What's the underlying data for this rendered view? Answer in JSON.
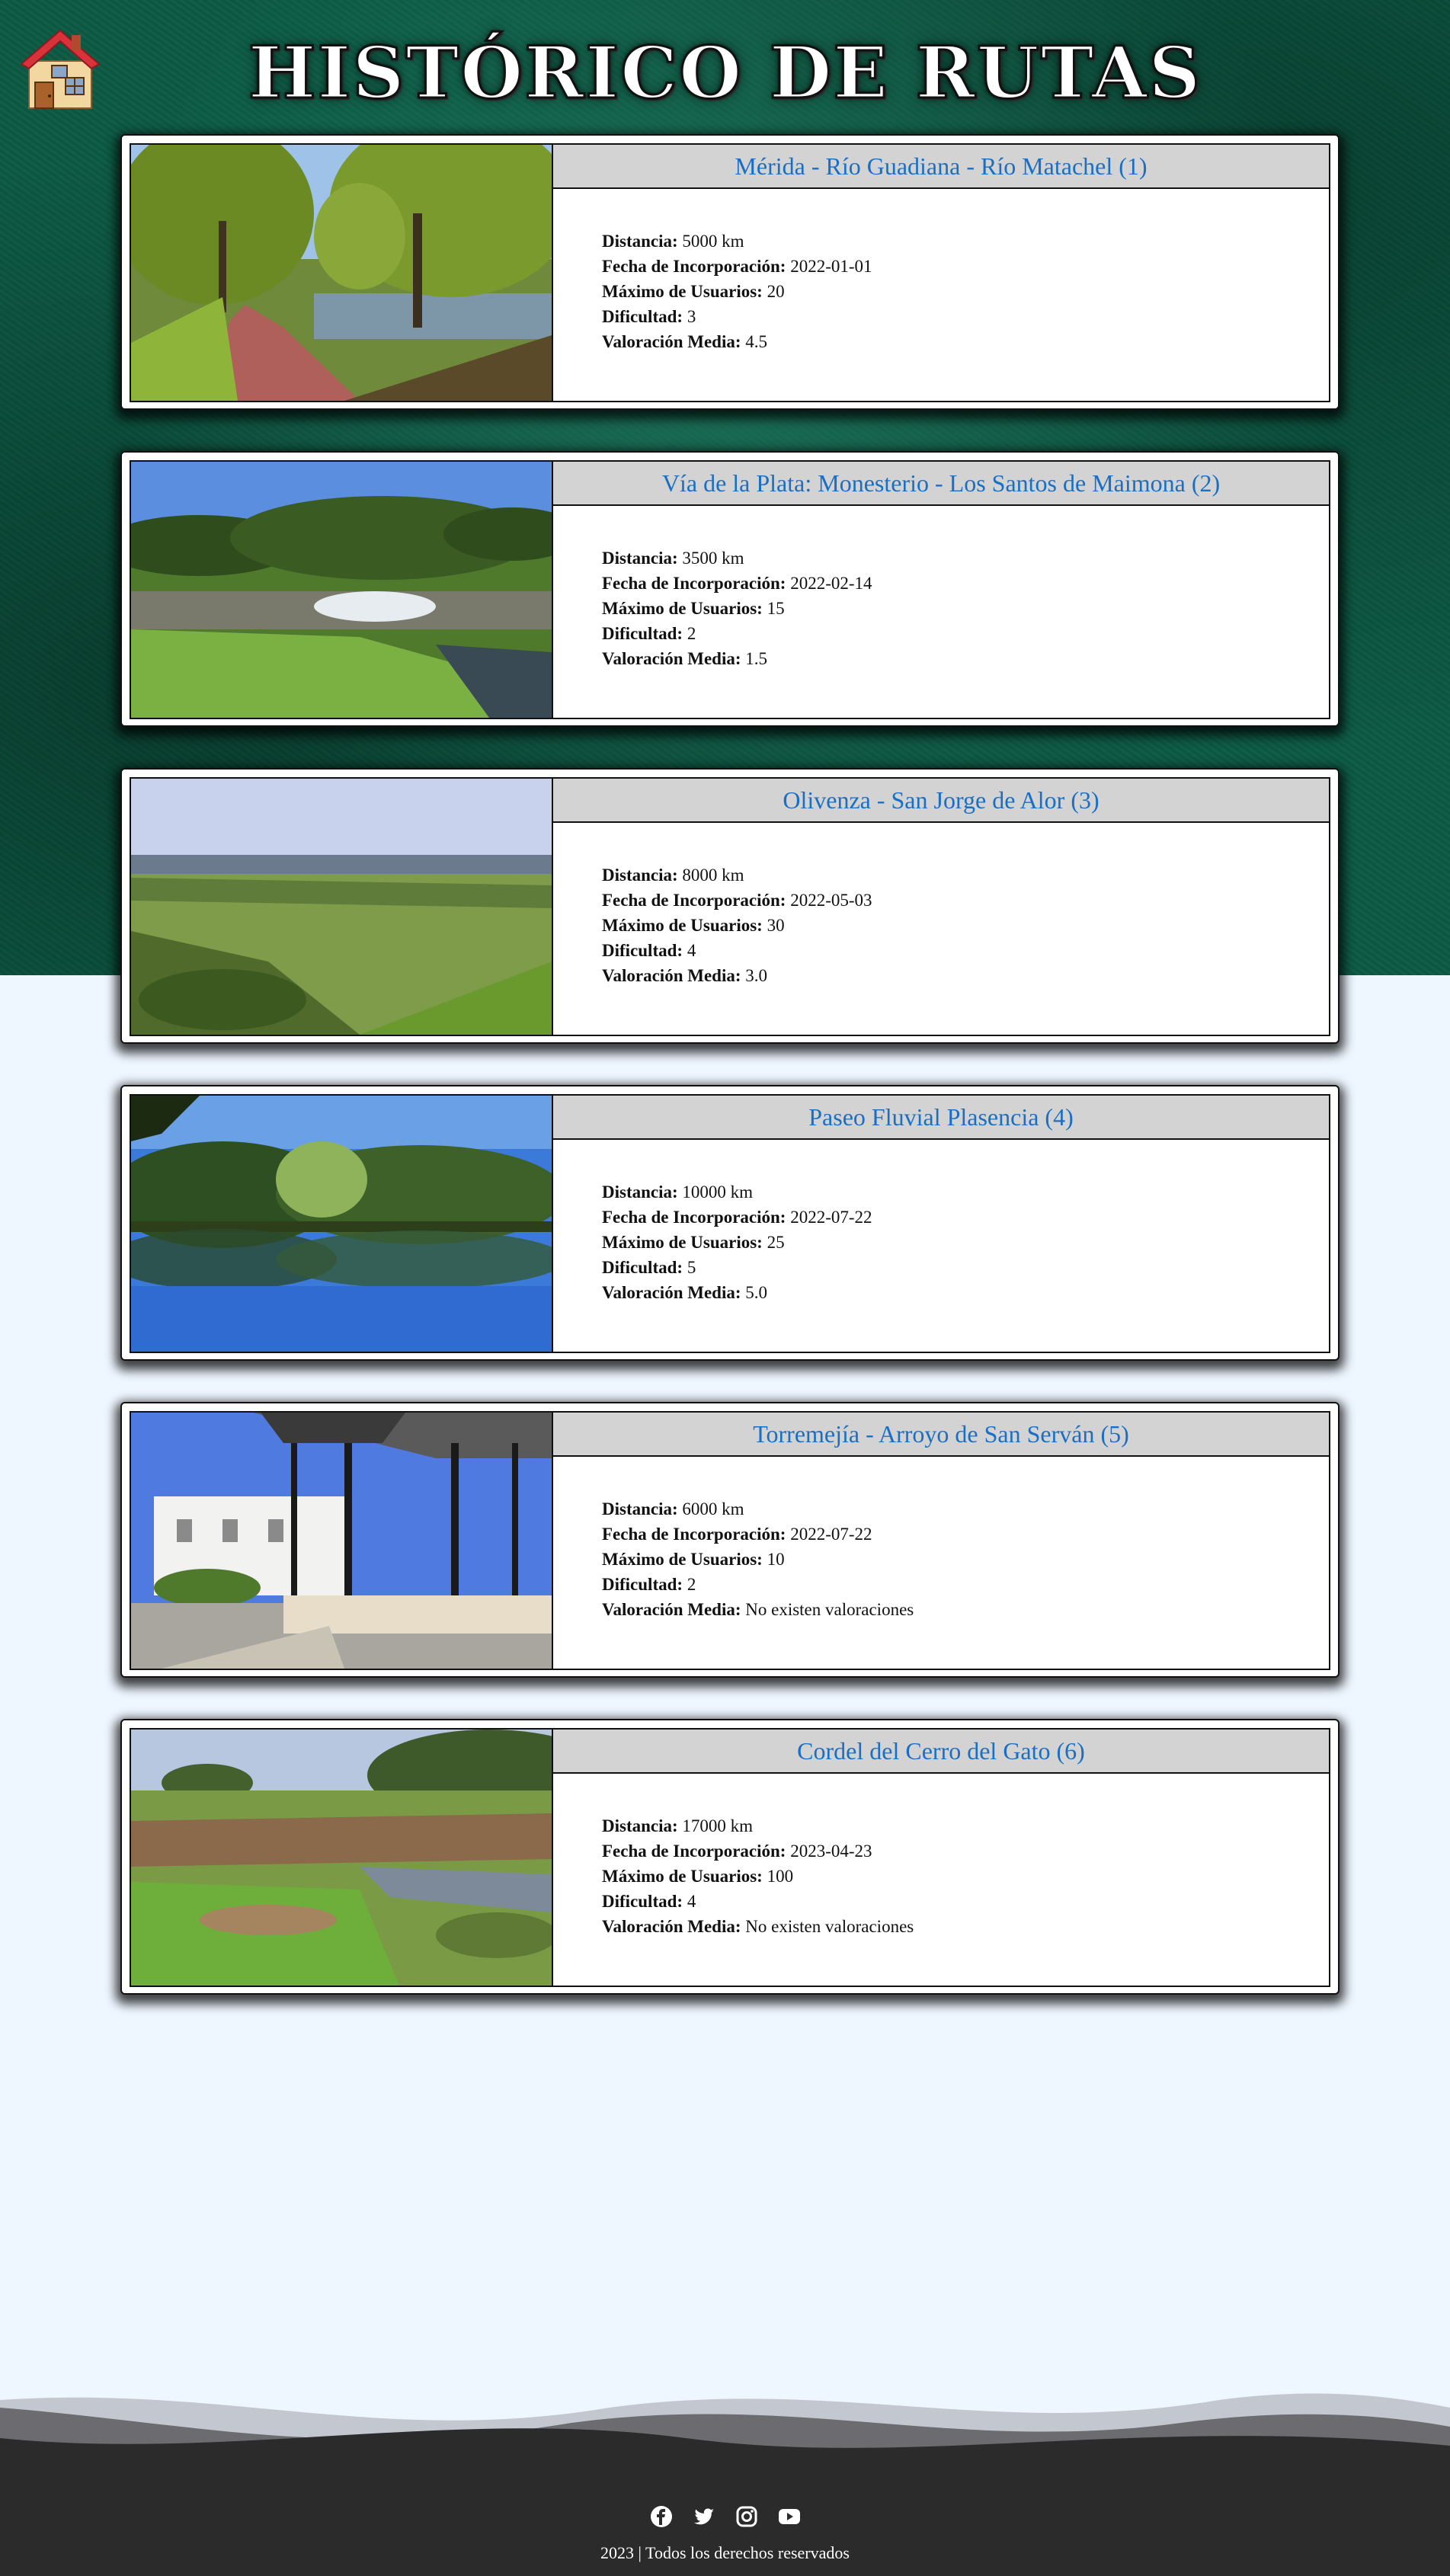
{
  "page": {
    "title": "HISTÓRICO DE RUTAS",
    "home_icon": "house-icon"
  },
  "routes": [
    {
      "name": "Mérida - Río Guadiana - Río Matachel (1)",
      "photo": "river-path-photo",
      "distance": "5000 km",
      "date": "2022-01-01",
      "max_users": "20",
      "difficulty": "3",
      "rating": "4.5"
    },
    {
      "name": "Vía de la Plata: Monesterio - Los Santos de Maimona (2)",
      "photo": "stream-meadow-photo",
      "distance": "3500 km",
      "date": "2022-02-14",
      "max_users": "15",
      "difficulty": "2",
      "rating": "1.5"
    },
    {
      "name": "Olivenza - San Jorge de Alor (3)",
      "photo": "valley-landscape-photo",
      "distance": "8000 km",
      "date": "2022-05-03",
      "max_users": "30",
      "difficulty": "4",
      "rating": "3.0"
    },
    {
      "name": "Paseo Fluvial Plasencia (4)",
      "photo": "lake-reflection-photo",
      "distance": "10000 km",
      "date": "2022-07-22",
      "max_users": "25",
      "difficulty": "5",
      "rating": "5.0"
    },
    {
      "name": "Torremejía - Arroyo de San Serván (5)",
      "photo": "town-bandstand-photo",
      "distance": "6000 km",
      "date": "2022-07-22",
      "max_users": "10",
      "difficulty": "2",
      "rating": "No existen valoraciones"
    },
    {
      "name": "Cordel del Cerro del Gato (6)",
      "photo": "creek-grassland-photo",
      "distance": "17000 km",
      "date": "2023-04-23",
      "max_users": "100",
      "difficulty": "4",
      "rating": "No existen valoraciones"
    }
  ],
  "labels": {
    "distance": "Distancia:",
    "date": "Fecha de Incorporación:",
    "max_users": "Máximo de Usuarios:",
    "difficulty": "Dificultad:",
    "rating": "Valoración Media:"
  },
  "footer": {
    "social": [
      "facebook-icon",
      "twitter-icon",
      "instagram-icon",
      "youtube-icon"
    ],
    "copyright": "2023 | Todos los derechos reservados"
  },
  "colors": {
    "hero_green": "#0c5a44",
    "title_link": "#1a6fc4",
    "card_header_bg": "#d3d3d3",
    "page_bg": "#eef6ff",
    "footer_bg": "#2b2b2b"
  }
}
